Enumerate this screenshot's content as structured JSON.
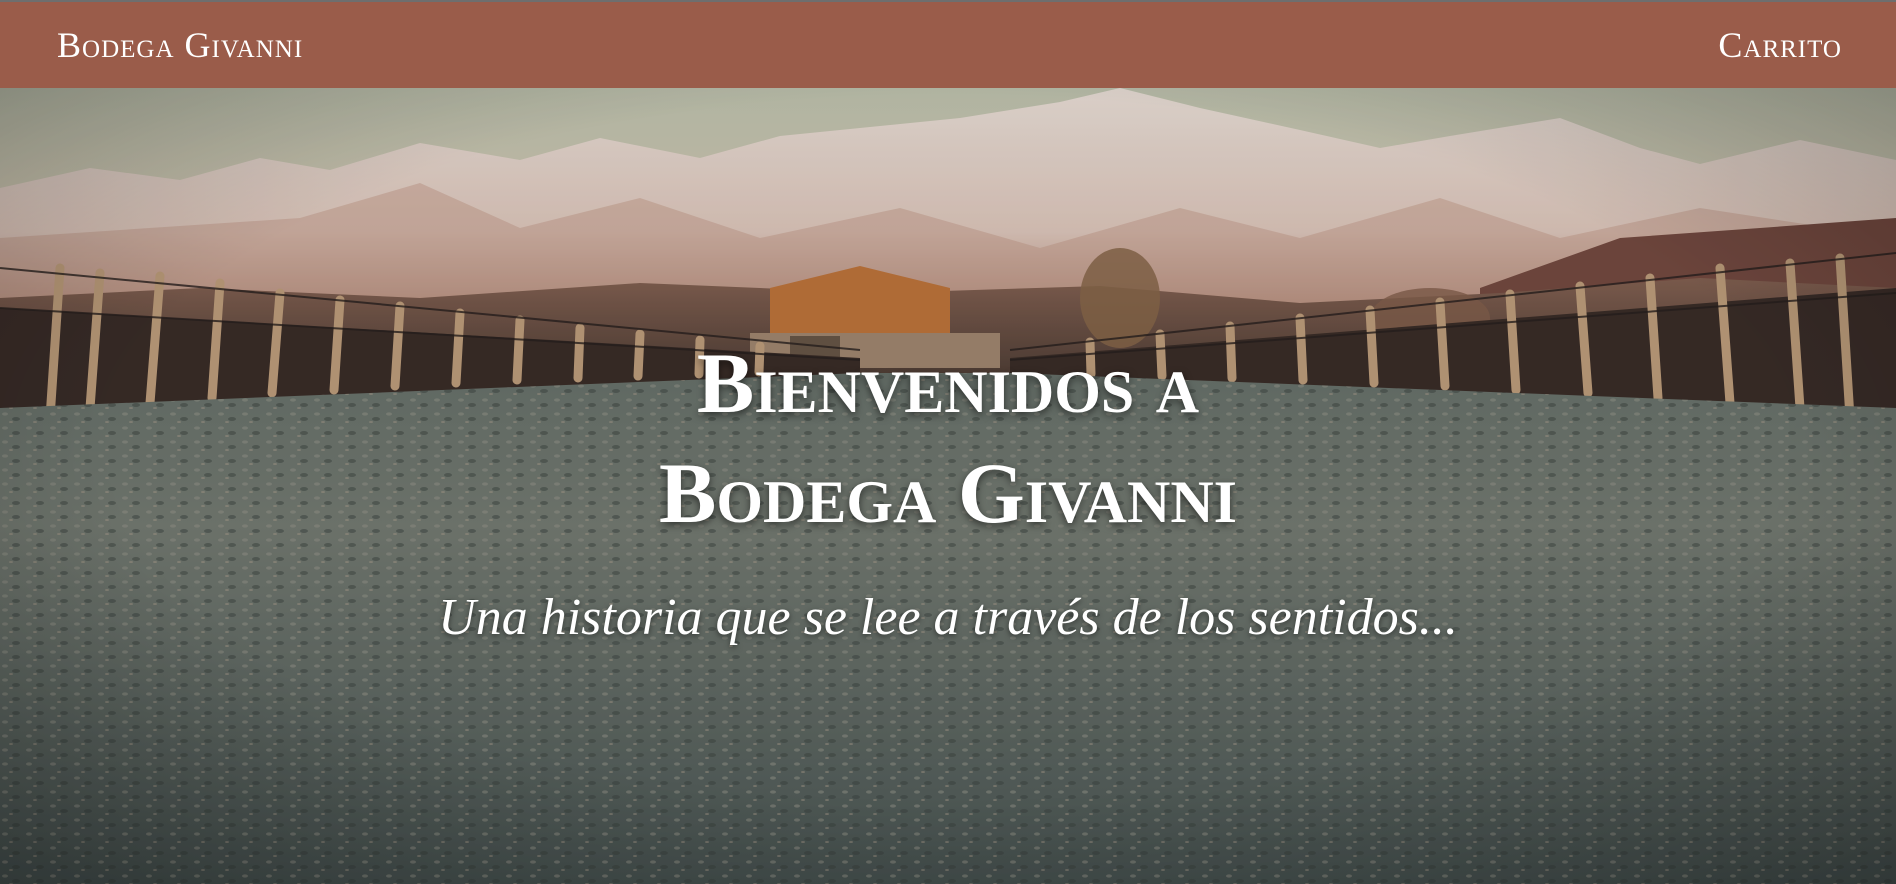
{
  "navbar": {
    "brand": "Bodega Givanni",
    "cart": "Carrito"
  },
  "hero": {
    "title_line1": "Bienvenidos a",
    "title_line2": "Bodega Givanni",
    "subtitle": "Una historia que se lee a través de los sentidos..."
  },
  "colors": {
    "navbar": "#9a5c4a",
    "text": "#ffffff"
  }
}
